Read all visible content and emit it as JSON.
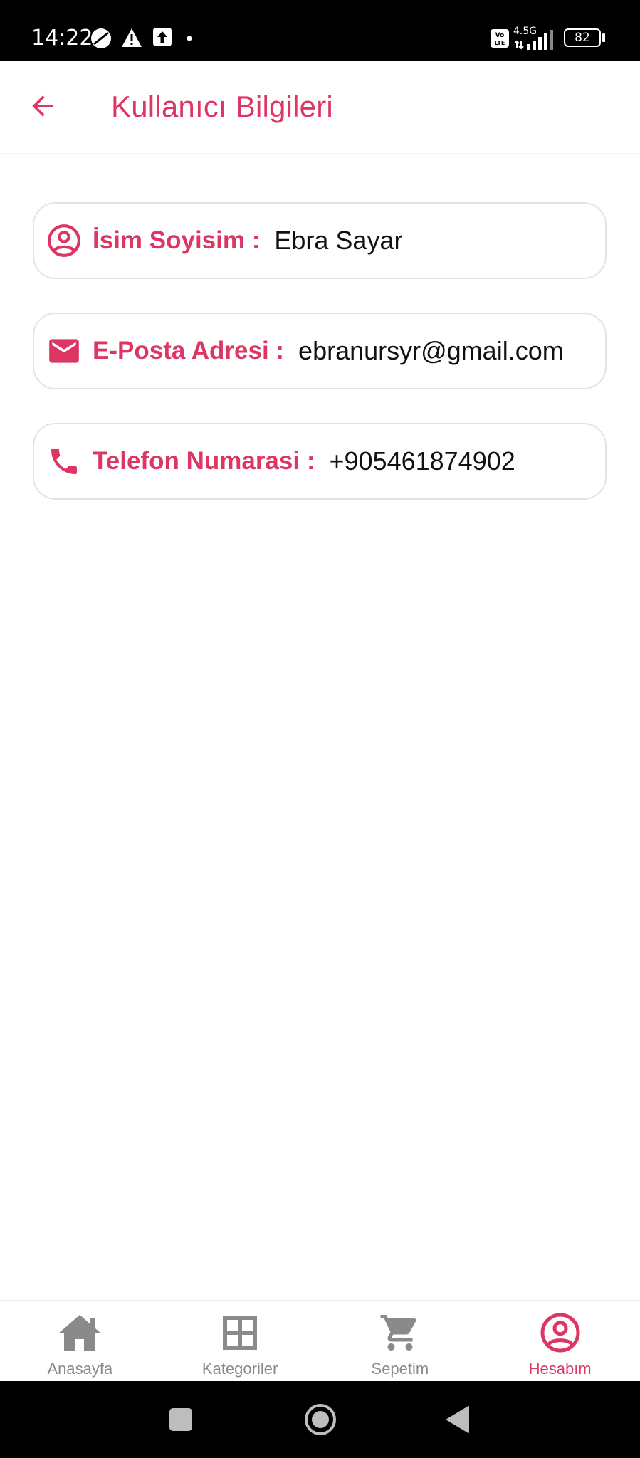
{
  "status_bar": {
    "time": "14:22",
    "network": "4.5G",
    "volte": "Vo LTE",
    "battery": "82"
  },
  "app_bar": {
    "title": "Kullanıcı Bilgileri",
    "back_icon": "arrow-back-icon"
  },
  "fields": [
    {
      "icon": "account-circle-icon",
      "label": "İsim Soyisim :",
      "value": "Ebra Sayar"
    },
    {
      "icon": "mail-icon",
      "label": "E-Posta Adresi :",
      "value": "ebranursyr@gmail.com"
    },
    {
      "icon": "phone-icon",
      "label": "Telefon Numarasi :",
      "value": "+905461874902"
    }
  ],
  "bottom_nav": {
    "items": [
      {
        "label": "Anasayfa",
        "icon": "home-icon",
        "active": false
      },
      {
        "label": "Kategoriler",
        "icon": "grid-icon",
        "active": false
      },
      {
        "label": "Sepetim",
        "icon": "cart-icon",
        "active": false
      },
      {
        "label": "Hesabım",
        "icon": "account-circle-icon",
        "active": true
      }
    ]
  },
  "colors": {
    "accent": "#dd3665",
    "inactive": "#8a8a8a",
    "card_border": "#e3e3e3"
  }
}
